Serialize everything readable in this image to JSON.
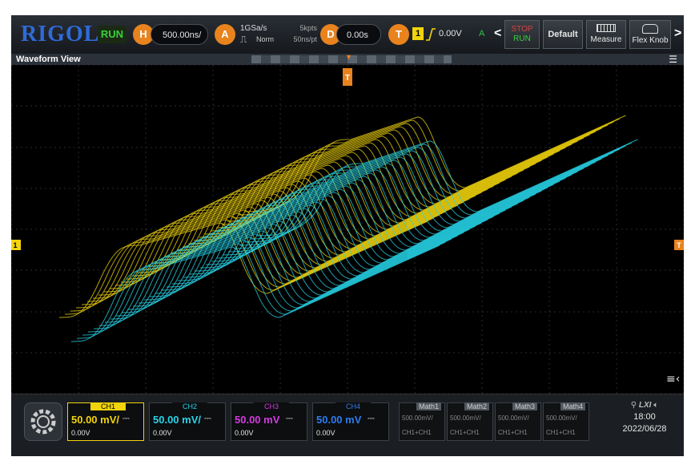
{
  "top_bar": {
    "brand": "RIGOL",
    "run_status": "RUN",
    "horizontal": {
      "icon_label": "H",
      "timebase": "500.00ns/"
    },
    "acquire": {
      "icon_label": "A",
      "sample_rate": "1GSa/s",
      "mode": "Norm",
      "mem_depth": "5kpts",
      "time_per_point": "50ns/pt"
    },
    "delay": {
      "icon_label": "D",
      "value": "0.00s"
    },
    "trigger": {
      "icon_label": "T",
      "source": "1",
      "level": "0.00V",
      "status": "A"
    },
    "buttons": {
      "stop_run": [
        "STOP",
        "RUN"
      ],
      "default": "Default",
      "measure": "Measure",
      "flex_knob": "Flex Knob"
    }
  },
  "title_strip": {
    "title": "Waveform View"
  },
  "markers": {
    "trigger_position": "T",
    "ch1_level": "1",
    "trigger_level": "T"
  },
  "channels": [
    {
      "name": "CH1",
      "scale": "50.00 mV/",
      "offset": "0.00V",
      "coupling_icon": "dc-coupling-icon",
      "color": "#f2d40c"
    },
    {
      "name": "CH2",
      "scale": "50.00 mV/",
      "offset": "0.00V",
      "coupling_icon": "dc-coupling-icon",
      "color": "#27d4e8"
    },
    {
      "name": "CH3",
      "scale": "50.00 mV",
      "offset": "0.00V",
      "coupling_icon": "dc-coupling-icon",
      "color": "#d43ce0"
    },
    {
      "name": "CH4",
      "scale": "50.00 mV",
      "offset": "0.00V",
      "coupling_icon": "dc-coupling-icon",
      "color": "#2f7cf0"
    }
  ],
  "math": [
    {
      "name": "Math1",
      "scale": "500.00mV/",
      "expr": "CH1+CH1"
    },
    {
      "name": "Math2",
      "scale": "500.00mV/",
      "expr": "CH1+CH1"
    },
    {
      "name": "Math3",
      "scale": "500.00mV/",
      "expr": "CH1+CH1"
    },
    {
      "name": "Math4",
      "scale": "500.00mV/",
      "expr": "CH1+CH1"
    }
  ],
  "status": {
    "icons": [
      "usb-icon",
      "lxi-icon",
      "speaker-icon"
    ],
    "lxi_label": "LXI",
    "time": "18:00",
    "date": "2022/06/28"
  },
  "colors": {
    "ch1": "#f2d40c",
    "ch2": "#27d4e8",
    "accent_orange": "#e8831e",
    "run_green": "#36d13c",
    "brand_blue": "#2e6bd8"
  }
}
